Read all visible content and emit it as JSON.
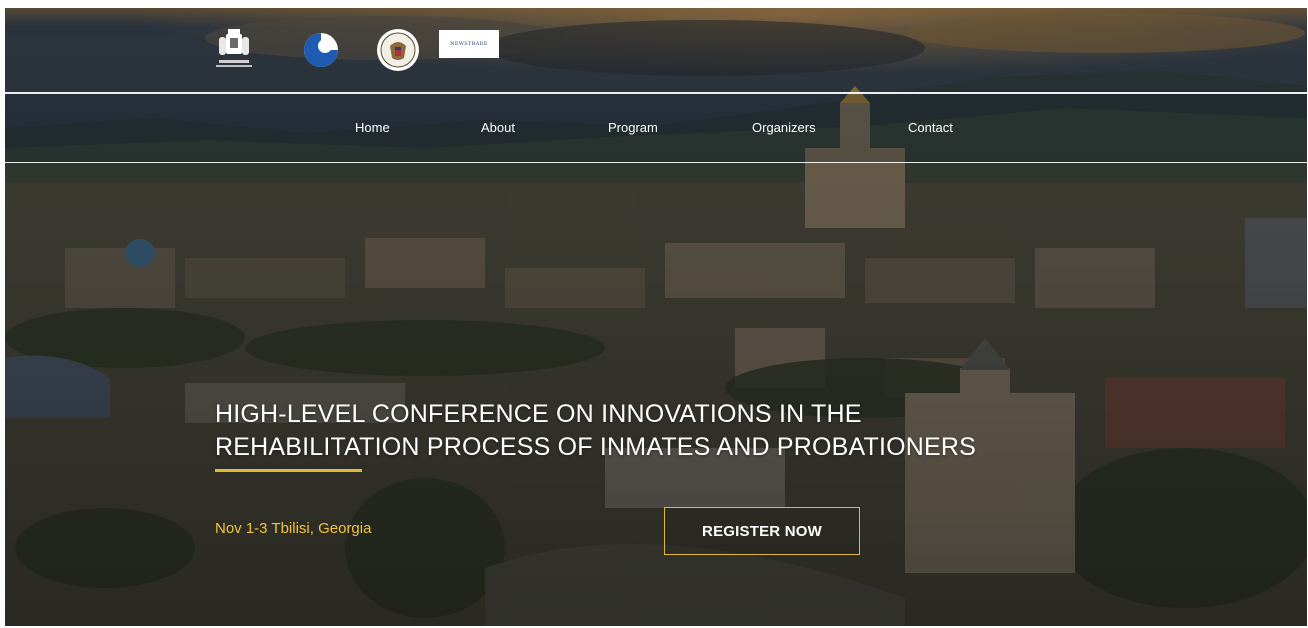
{
  "logos": {
    "text_logo": "NEWSTRADE"
  },
  "nav": {
    "items": [
      {
        "label": "Home"
      },
      {
        "label": "About"
      },
      {
        "label": "Program"
      },
      {
        "label": "Organizers"
      },
      {
        "label": "Contact"
      }
    ]
  },
  "hero": {
    "title_line1": "HIGH-LEVEL CONFERENCE ON INNOVATIONS IN THE",
    "title_line2": "REHABILITATION PROCESS OF INMATES AND PROBATIONERS",
    "dates": "Nov 1-3 Tbilisi, Georgia",
    "register_label": "REGISTER NOW"
  },
  "colors": {
    "accent_gold": "#e2b83a",
    "date_gold": "#f0c53d",
    "nav_text": "#ffffff",
    "title_text": "#ffffff"
  },
  "icons": [
    "coat-of-arms-icon",
    "ring-logo-icon",
    "us-seal-icon"
  ]
}
